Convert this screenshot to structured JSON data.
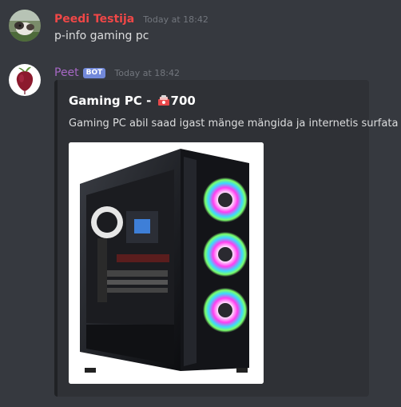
{
  "messages": [
    {
      "author": "Peedi Testija",
      "author_color": "#f04747",
      "timestamp": "Today at 18:42",
      "text": "p-info gaming pc",
      "avatar_icon": "dog-avatar"
    },
    {
      "author": "Peet",
      "author_color": "#a667c4",
      "bot_tag": "BOT",
      "timestamp": "Today at 18:42",
      "avatar_icon": "beet-avatar",
      "embed": {
        "title_prefix": "Gaming PC - ",
        "title_icon": "money-icon",
        "title_value": "700",
        "description": "Gaming PC abil saad igast mänge mängida ja internetis surfata",
        "image_icon": "gaming-pc-case-image"
      }
    }
  ],
  "colors": {
    "background": "#36393f",
    "embed_background": "#2f3136",
    "timestamp": "#72767d",
    "bot_tag": "#7289da"
  }
}
